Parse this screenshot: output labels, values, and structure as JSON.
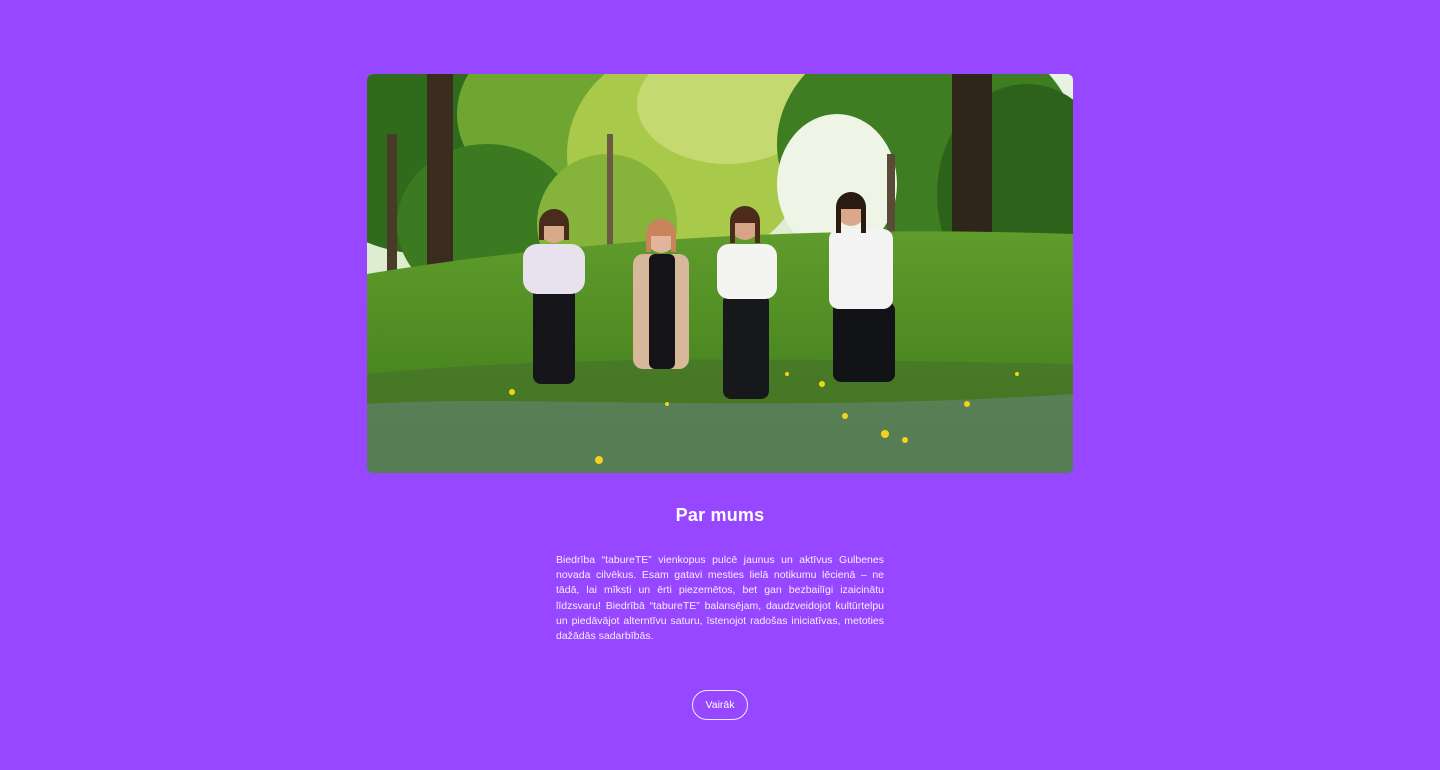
{
  "hero_image": {
    "alt_description": "group-photo-in-meadow"
  },
  "about": {
    "title": "Par mums",
    "text": "Biedrība “tabureTE” vienkopus pulcē jaunus un aktīvus Gulbenes novada cilvēkus. Esam gatavi mesties lielā notikumu lēcienā – ne tādā, lai mīksti un ērti piezemētos, bet gan bezbailīgi izaicinātu līdzsvaru! Biedrībā “tabureTE” balansējam, daudzveidojot kultūrtelpu un piedāvājot alterntīvu saturu, īstenojot radošas iniciatīvas, metoties dažādās sadarbībās.",
    "button_label": "Vairāk"
  },
  "colors": {
    "background": "#9747ff",
    "text": "#ffffff"
  }
}
